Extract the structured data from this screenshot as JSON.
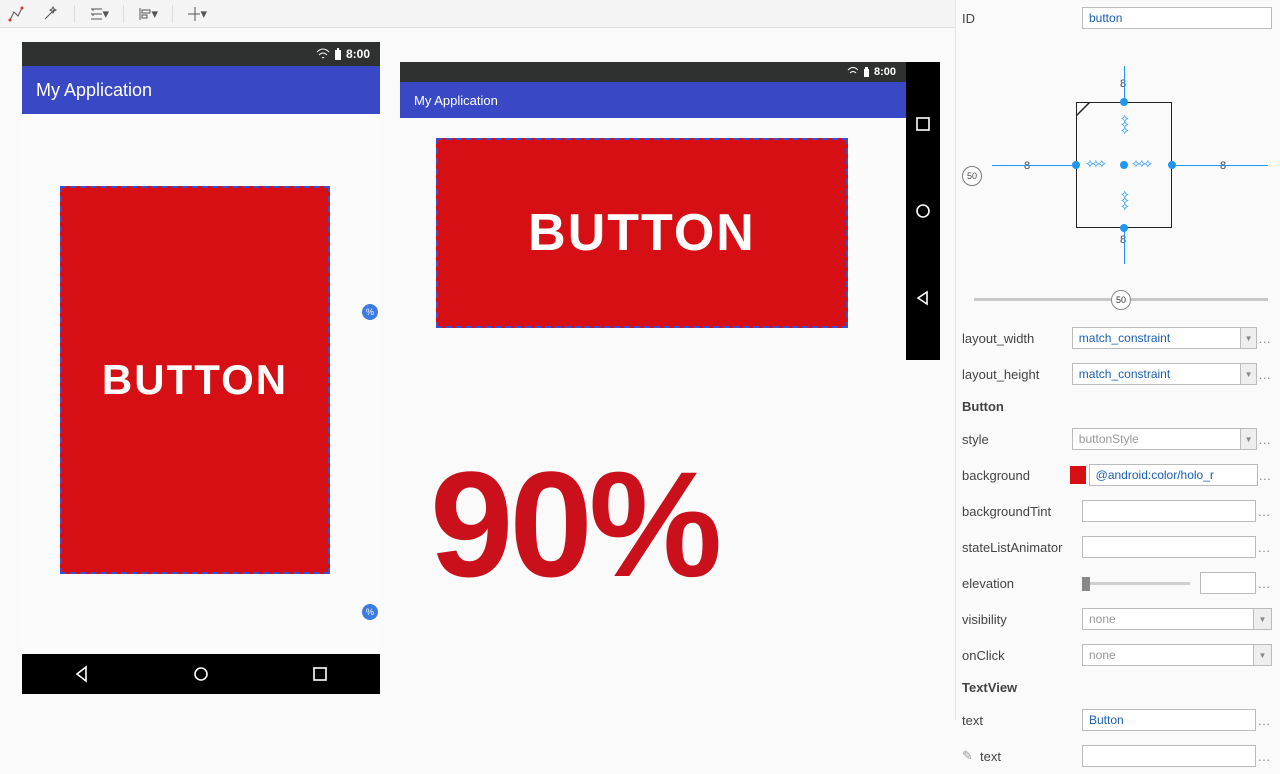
{
  "toolbar": {
    "icons": [
      "constraint-icon",
      "magic-icon",
      "dims-icon",
      "align-icon",
      "guides-icon",
      "text-icon"
    ]
  },
  "status": {
    "time": "8:00"
  },
  "app": {
    "title": "My Application"
  },
  "button": {
    "label": "BUTTON"
  },
  "overlay": {
    "percent": "90%"
  },
  "props": {
    "id_label": "ID",
    "id_value": "button",
    "ruler_value": "50",
    "constraints": {
      "top": "8",
      "bottom": "8",
      "left": "8",
      "right": "8"
    },
    "bias_value": "50",
    "layout_width_label": "layout_width",
    "layout_width_value": "match_constraint",
    "layout_height_label": "layout_height",
    "layout_height_value": "match_constraint",
    "section_button": "Button",
    "style_label": "style",
    "style_value": "buttonStyle",
    "background_label": "background",
    "background_value": "@android:color/holo_r",
    "backgroundTint_label": "backgroundTint",
    "backgroundTint_value": "",
    "stateListAnimator_label": "stateListAnimator",
    "stateListAnimator_value": "",
    "elevation_label": "elevation",
    "elevation_value": "",
    "visibility_label": "visibility",
    "visibility_value": "none",
    "onClick_label": "onClick",
    "onClick_value": "none",
    "section_textview": "TextView",
    "text_label": "text",
    "text_value": "Button",
    "text2_label": "text"
  }
}
